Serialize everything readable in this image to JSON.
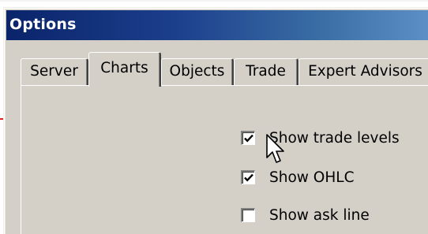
{
  "window": {
    "title": "Options"
  },
  "tabs": [
    {
      "label": "Server",
      "active": false
    },
    {
      "label": "Charts",
      "active": true
    },
    {
      "label": "Objects",
      "active": false
    },
    {
      "label": "Trade",
      "active": false
    },
    {
      "label": "Expert Advisors",
      "active": false
    }
  ],
  "options": [
    {
      "label": "Show trade levels",
      "checked": true
    },
    {
      "label": "Show OHLC",
      "checked": true
    },
    {
      "label": "Show ask line",
      "checked": false
    }
  ],
  "icons": {
    "check": "check-mark",
    "cursor": "arrow-cursor"
  },
  "colors": {
    "titlebar_start": "#0a246a",
    "titlebar_end": "#5b8fc6",
    "dialog_face": "#d4d0c8"
  }
}
